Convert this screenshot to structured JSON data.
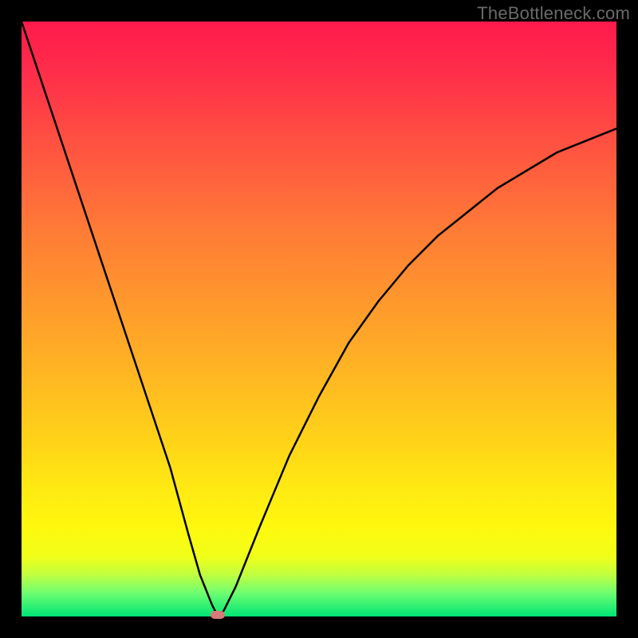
{
  "watermark": "TheBottleneck.com",
  "chart_data": {
    "type": "line",
    "title": "",
    "xlabel": "",
    "ylabel": "",
    "xlim": [
      0,
      100
    ],
    "ylim": [
      0,
      100
    ],
    "series": [
      {
        "name": "bottleneck-curve",
        "x": [
          0,
          5,
          10,
          15,
          20,
          25,
          28,
          30,
          32,
          33,
          34,
          36,
          40,
          45,
          50,
          55,
          60,
          65,
          70,
          75,
          80,
          85,
          90,
          95,
          100
        ],
        "values": [
          100,
          85,
          70,
          55,
          40,
          25,
          14,
          7,
          2,
          0,
          1,
          5,
          15,
          27,
          37,
          46,
          53,
          59,
          64,
          68,
          72,
          75,
          78,
          80,
          82
        ]
      }
    ],
    "marker": {
      "x": 33,
      "y": 0
    },
    "gradient_stops": [
      {
        "pos": 0,
        "color": "#ff1a4c"
      },
      {
        "pos": 50,
        "color": "#ffb822"
      },
      {
        "pos": 85,
        "color": "#fff80e"
      },
      {
        "pos": 100,
        "color": "#00e676"
      }
    ]
  }
}
